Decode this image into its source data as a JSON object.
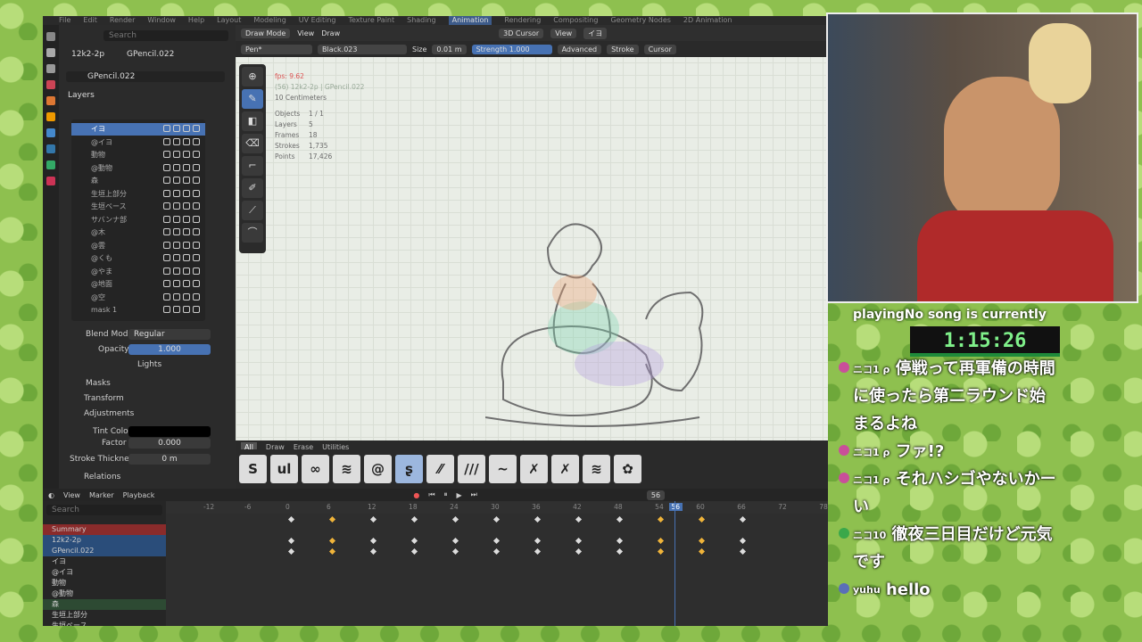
{
  "topmenu": {
    "file": "File",
    "edit": "Edit",
    "render": "Render",
    "window": "Window",
    "help": "Help",
    "ws1": "Layout",
    "ws2": "Modeling",
    "ws3": "UV Editing",
    "ws4": "Texture Paint",
    "ws5": "Shading",
    "ws6": "Animation",
    "ws7": "Rendering",
    "ws8": "Compositing",
    "ws9": "Geometry Nodes",
    "ws10": "2D Animation"
  },
  "props": {
    "search_placeholder": "Search",
    "object_name": "12k2-2p",
    "data_name": "GPencil.022",
    "gpencil_field": "GPencil.022",
    "layers_heading": "Layers",
    "layers": [
      "イヨ",
      "@イヨ",
      "動物",
      "@動物",
      "森",
      "生垣上部分",
      "生垣ベース",
      "サバンナ部",
      "@木",
      "@雲",
      "@くも",
      "@やま",
      "@地面",
      "@空",
      "mask 1"
    ],
    "extra_label": "モデ",
    "blend_mode_label": "Blend Mode",
    "blend_mode_value": "Regular",
    "opacity_label": "Opacity",
    "opacity_value": "1.000",
    "lights_label": "Lights",
    "masks": "Masks",
    "transform": "Transform",
    "adjustments": "Adjustments",
    "tint_label": "Tint Color",
    "factor_label": "Factor",
    "factor_value": "0.000",
    "stroke_thickness_label": "Stroke Thickness",
    "stroke_thickness_value": "0 m",
    "relations": "Relations",
    "display": "Display"
  },
  "viewport": {
    "mode": "Draw Mode",
    "view": "View",
    "draw": "Draw",
    "cursor": "3D Cursor",
    "view2": "View",
    "layer": "イヨ",
    "brush": "Pen*",
    "material": "Black.023",
    "size_label": "Size",
    "size_value": "0.01 m",
    "strength_label": "Strength",
    "strength_value": "1.000",
    "advanced": "Advanced",
    "stroke": "Stroke",
    "cursor2": "Cursor",
    "fps": "fps: 9.62",
    "objinfo": "(56) 12k2-2p | GPencil.022",
    "units": "10 Centimeters",
    "stats": [
      [
        "Objects",
        "1 / 1"
      ],
      [
        "Layers",
        "5"
      ],
      [
        "Frames",
        "18"
      ],
      [
        "Strokes",
        "1,735"
      ],
      [
        "Points",
        "17,426"
      ]
    ]
  },
  "brushbar": {
    "tabs": [
      "All",
      "Draw",
      "Erase",
      "Utilities"
    ],
    "brushes": [
      "S",
      "ul",
      "∞",
      "≋",
      "@",
      "ʂ",
      "⁄⁄",
      "///",
      "~",
      "✗",
      "✗",
      "≋",
      "✿"
    ]
  },
  "timeline": {
    "view": "View",
    "marker": "Marker",
    "playback": "Playback",
    "current_frame": "56",
    "search_placeholder": "Search",
    "ticks": [
      "-12",
      "-6",
      "0",
      "6",
      "12",
      "18",
      "24",
      "30",
      "36",
      "42",
      "48",
      "54",
      "56",
      "60",
      "66",
      "72",
      "78"
    ],
    "channels": [
      "Summary",
      "12k2-2p",
      "GPencil.022",
      "イヨ",
      "@イヨ",
      "動物",
      "@動物",
      "森",
      "生垣上部分",
      "生垣ベース"
    ]
  },
  "overlay": {
    "song": "playingNo song is currently",
    "timer": "1:15:26",
    "messages": [
      {
        "user": "ニコ1 ρ",
        "text": "停戦って再軍備の時間",
        "color": "#c94f9a"
      },
      {
        "user": "",
        "text": "に使ったら第二ラウンド始",
        "color": ""
      },
      {
        "user": "",
        "text": "まるよね",
        "color": ""
      },
      {
        "user": "ニコ1 ρ",
        "text": "ファ!?",
        "color": "#c94f9a"
      },
      {
        "user": "ニコ1 ρ",
        "text": "それハシゴやないかー",
        "color": "#c94f9a"
      },
      {
        "user": "",
        "text": "い",
        "color": ""
      },
      {
        "user": "ニコ10",
        "text": "徹夜三日目だけど元気",
        "color": "#3aa84a"
      },
      {
        "user": "",
        "text": "です",
        "color": ""
      },
      {
        "user": "yuhu",
        "text": "hello",
        "color": "#5a6fb8"
      }
    ]
  }
}
